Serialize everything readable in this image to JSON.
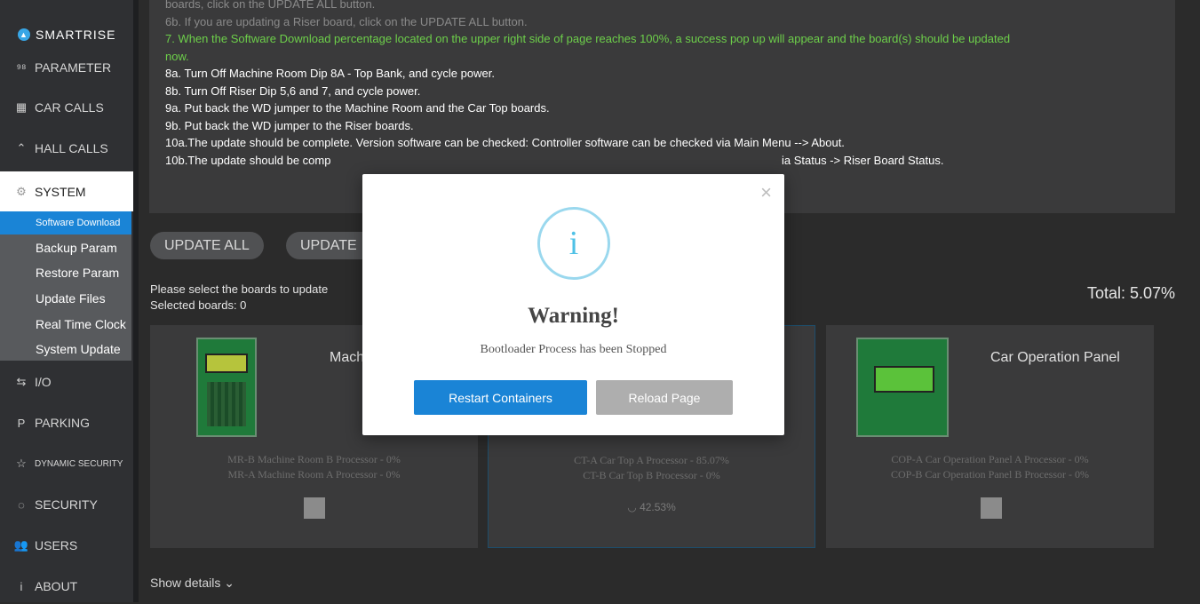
{
  "app": {
    "logo_text": "SMARTRISE"
  },
  "sidebar": {
    "items": [
      {
        "label": "PARAMETER",
        "icon": "parameter-icon",
        "glyph": "⁹⁸"
      },
      {
        "label": "CAR CALLS",
        "icon": "car-calls-icon",
        "glyph": "▦"
      },
      {
        "label": "HALL CALLS",
        "icon": "hall-calls-icon",
        "glyph": "⌃"
      },
      {
        "label": "SYSTEM",
        "icon": "gear-icon",
        "glyph": "⚙"
      },
      {
        "label": "I/O",
        "icon": "io-arrows-icon",
        "glyph": "⇆"
      },
      {
        "label": "PARKING",
        "icon": "parking-icon",
        "glyph": "P"
      },
      {
        "label": "DYNAMIC SECURITY",
        "icon": "star-icon",
        "glyph": "☆"
      },
      {
        "label": "SECURITY",
        "icon": "shield-icon",
        "glyph": "◌"
      },
      {
        "label": "USERS",
        "icon": "users-icon",
        "glyph": "👥"
      },
      {
        "label": "ABOUT",
        "icon": "info-icon",
        "glyph": "i"
      }
    ],
    "sub_items": [
      {
        "label": "Software Download"
      },
      {
        "label": "Backup Param"
      },
      {
        "label": "Restore Param"
      },
      {
        "label": "Update Files"
      },
      {
        "label": "Real Time Clock"
      },
      {
        "label": "System Update"
      }
    ]
  },
  "instructions": [
    "boards, click on the UPDATE ALL button.",
    "6b. If you are updating a Riser board, click on the UPDATE ALL button.",
    "7. When the Software Download percentage located on the upper right side of page reaches 100%, a success pop up will appear and the board(s) should be updated",
    "now.",
    "8a. Turn Off Machine Room Dip 8A - Top Bank, and cycle power.",
    "8b. Turn Off Riser Dip 5,6 and 7, and cycle power.",
    "9a. Put back the WD jumper to the Machine Room and the Car Top boards.",
    "9b. Put back the WD jumper to the Riser boards.",
    "10a.The update should be complete. Version software can be checked: Controller software can be checked via Main Menu --> About.",
    "10b.The update should be comp",
    "ia Status -> Riser Board Status."
  ],
  "actions": {
    "update_all": "UPDATE ALL",
    "update": "UPDATE"
  },
  "selection": {
    "prompt": "Please select the boards to update",
    "selected": "Selected boards: 0",
    "total": "Total: 5.07%"
  },
  "cards": [
    {
      "title": "Mach",
      "lines": [
        "MR-B Machine Room B Processor - 0%",
        "MR-A Machine Room A Processor - 0%"
      ],
      "progress": ""
    },
    {
      "title": "",
      "lines": [
        "CT-A Car Top A Processor - 85.07%",
        "CT-B Car Top B Processor - 0%"
      ],
      "progress": "42.53%"
    },
    {
      "title": "Car Operation Panel",
      "lines": [
        "COP-A Car Operation Panel A Processor - 0%",
        "COP-B Car Operation Panel B Processor - 0%"
      ],
      "progress": ""
    }
  ],
  "footer": {
    "show_details": "Show details"
  },
  "modal": {
    "icon": "info-icon",
    "glyph": "i",
    "close": "×",
    "title": "Warning!",
    "message": "Bootloader Process has been Stopped",
    "primary_button": "Restart Containers",
    "secondary_button": "Reload Page"
  },
  "colors": {
    "accent": "#1a84d6",
    "success_text": "#6dcf4a",
    "sidebar_bg": "#2f3033"
  }
}
